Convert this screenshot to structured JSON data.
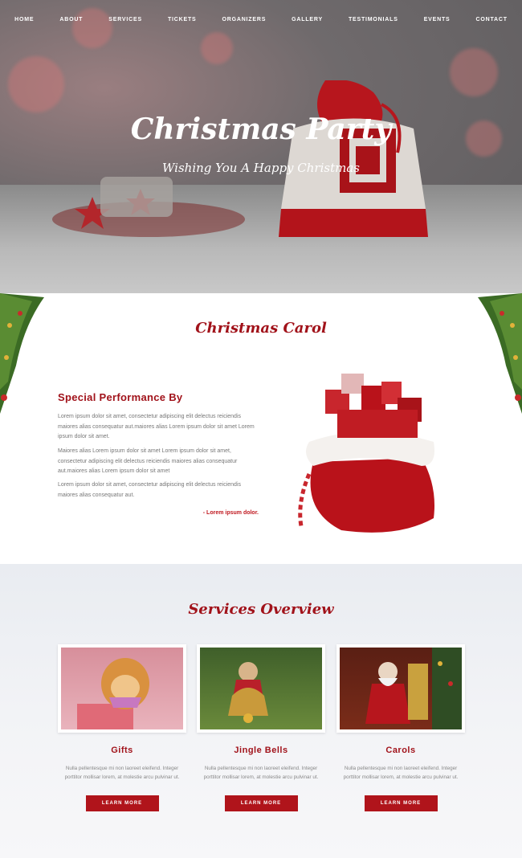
{
  "nav": {
    "items": [
      "HOME",
      "ABOUT",
      "SERVICES",
      "TICKETS",
      "ORGANIZERS",
      "GALLERY",
      "TESTIMONIALS",
      "EVENTS",
      "CONTACT"
    ]
  },
  "hero": {
    "title": "Christmas Party",
    "subtitle": "Wishing You A Happy Christmas"
  },
  "carol": {
    "title": "Christmas Carol",
    "performance_title": "Special Performance By",
    "paragraphs": [
      "Lorem ipsum dolor sit amet, consectetur adipiscing elit delectus reiciendis maiores alias consequatur aut.maiores alias Lorem ipsum dolor sit amet Lorem ipsum dolor sit amet.",
      "Maiores alias Lorem ipsum dolor sit amet Lorem ipsum dolor sit amet, consectetur adipiscing elit delectus reiciendis maiores alias consequatur aut.maiores alias Lorem ipsum dolor sit amet",
      "Lorem ipsum dolor sit amet, consectetur adipiscing elit delectus reiciendis maiores alias consequatur aut."
    ],
    "signature": "- Lorem ipsum dolor."
  },
  "services": {
    "title": "Services Overview",
    "cards": [
      {
        "title": "Gifts",
        "text": "Nulla pellentesque mi non laoreet eleifend. Integer porttitor mollisar lorem, at molestie arcu pulvinar ut.",
        "button": "LEARN MORE"
      },
      {
        "title": "Jingle Bells",
        "text": "Nulla pellentesque mi non laoreet eleifend. Integer porttitor mollisar lorem, at molestie arcu pulvinar ut.",
        "button": "LEARN MORE"
      },
      {
        "title": "Carols",
        "text": "Nulla pellentesque mi non laoreet eleifend. Integer porttitor mollisar lorem, at molestie arcu pulvinar ut.",
        "button": "LEARN MORE"
      }
    ]
  },
  "colors": {
    "accent": "#a1121a",
    "button": "#b0141b"
  }
}
